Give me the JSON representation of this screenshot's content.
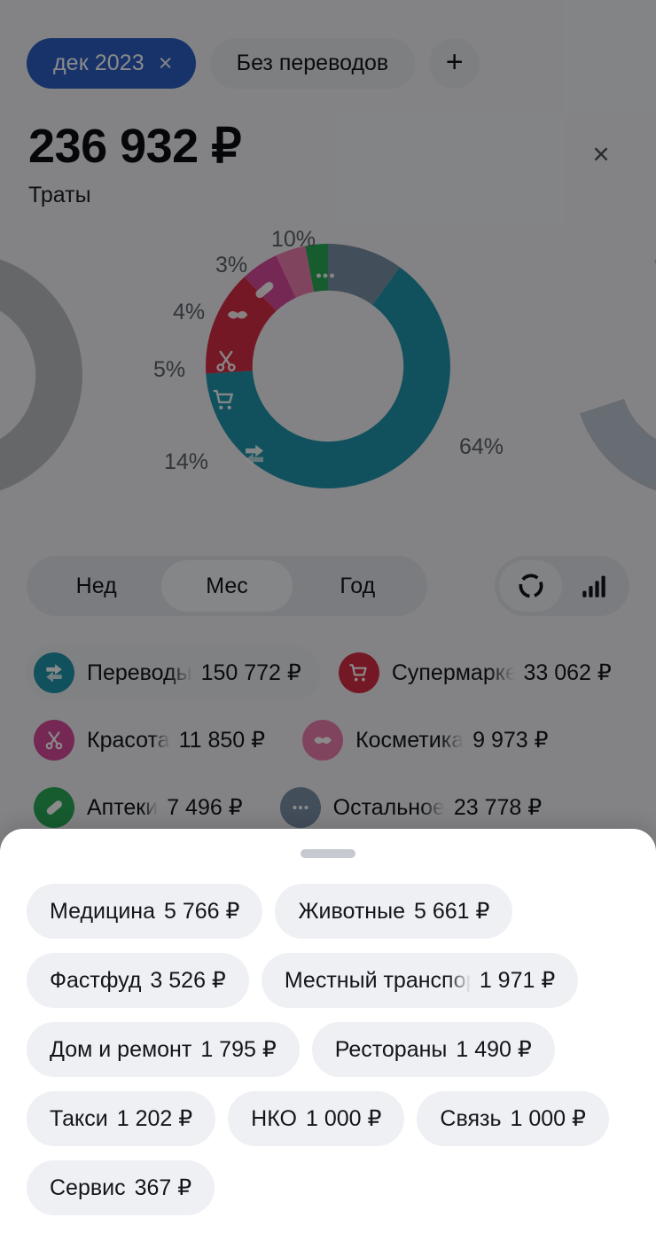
{
  "filters": {
    "date_chip": {
      "label": "дек 2023",
      "close_icon": "×"
    },
    "no_transfers_chip": "Без переводов",
    "add_filter": "+"
  },
  "header": {
    "amount": "236 932 ₽",
    "subtitle": "Траты",
    "close_icon": "×"
  },
  "period_tabs": [
    {
      "label": "Нед",
      "active": false
    },
    {
      "label": "Мес",
      "active": true
    },
    {
      "label": "Год",
      "active": false
    }
  ],
  "view_toggle": [
    {
      "name": "donut-view",
      "active": true
    },
    {
      "name": "bars-view",
      "active": false
    }
  ],
  "legend": [
    {
      "name": "Переводы",
      "value": "150 772 ₽",
      "color": "#2196ae",
      "icon": "transfer-icon",
      "highlighted": true
    },
    {
      "name": "Супермаркеты",
      "value": "33 062 ₽",
      "color": "#d92d45",
      "icon": "cart-icon",
      "highlighted": false
    },
    {
      "name": "Красота",
      "value": "11 850 ₽",
      "color": "#d84b9c",
      "icon": "scissors-icon",
      "highlighted": false
    },
    {
      "name": "Косметика",
      "value": "9 973 ₽",
      "color": "#ef7fb0",
      "icon": "lips-icon",
      "highlighted": false
    },
    {
      "name": "Аптеки",
      "value": "7 496 ₽",
      "color": "#2aab57",
      "icon": "pill-icon",
      "highlighted": false
    },
    {
      "name": "Остальное",
      "value": "23 778 ₽",
      "color": "#7d90a8",
      "icon": "ellipsis-icon",
      "highlighted": false
    }
  ],
  "sheet": {
    "handle": "drag-handle",
    "chips": [
      {
        "label": "Медицина",
        "value": "5 766 ₽",
        "truncated": false
      },
      {
        "label": "Животные",
        "value": "5 661 ₽",
        "truncated": false
      },
      {
        "label": "Фастфуд",
        "value": "3 526 ₽",
        "truncated": false
      },
      {
        "label": "Местный транспорт",
        "value": "1 971 ₽",
        "truncated": true
      },
      {
        "label": "Дом и ремонт",
        "value": "1 795 ₽",
        "truncated": false
      },
      {
        "label": "Рестораны",
        "value": "1 490 ₽",
        "truncated": false
      },
      {
        "label": "Такси",
        "value": "1 202 ₽",
        "truncated": false
      },
      {
        "label": "НКО",
        "value": "1 000 ₽",
        "truncated": false
      },
      {
        "label": "Связь",
        "value": "1 000 ₽",
        "truncated": false
      },
      {
        "label": "Сервис",
        "value": "367 ₽",
        "truncated": false
      }
    ]
  },
  "chart_data": {
    "type": "pie",
    "title": "Траты",
    "total": "236 932 ₽",
    "unit": "₽",
    "legend_position": "below",
    "categories": [
      "Остальное",
      "Переводы",
      "Супермаркеты",
      "Красота",
      "Косметика",
      "Аптеки"
    ],
    "values": [
      23778,
      150772,
      33062,
      11850,
      9973,
      7496
    ],
    "percent_labels": [
      "10%",
      "64%",
      "14%",
      "5%",
      "4%",
      "3%"
    ],
    "colors": [
      "#7d90a8",
      "#2196ae",
      "#d92d45",
      "#d84b9c",
      "#ef7fb0",
      "#2aab57"
    ],
    "segments": [
      {
        "name": "Остальное",
        "percent": 10,
        "value": 23778,
        "color": "#7d90a8",
        "icon": "ellipsis-icon",
        "start_deg": 0,
        "end_deg": 36
      },
      {
        "name": "Переводы",
        "percent": 64,
        "value": 150772,
        "color": "#2196ae",
        "icon": "transfer-icon",
        "start_deg": 36,
        "end_deg": 266
      },
      {
        "name": "Супермаркеты",
        "percent": 14,
        "value": 33062,
        "color": "#d92d45",
        "icon": "cart-icon",
        "start_deg": 266,
        "end_deg": 317
      },
      {
        "name": "Красота",
        "percent": 5,
        "value": 11850,
        "color": "#d84b9c",
        "icon": "scissors-icon",
        "start_deg": 317,
        "end_deg": 335
      },
      {
        "name": "Косметика",
        "percent": 4,
        "value": 9973,
        "color": "#ef7fb0",
        "icon": "lips-icon",
        "start_deg": 335,
        "end_deg": 349
      },
      {
        "name": "Аптеки",
        "percent": 3,
        "value": 7496,
        "color": "#2aab57",
        "icon": "pill-icon",
        "start_deg": 349,
        "end_deg": 360
      }
    ],
    "pct_10": "10%",
    "pct_64": "64%",
    "pct_14": "14%",
    "pct_5": "5%",
    "pct_4": "4%",
    "pct_3": "3%"
  }
}
